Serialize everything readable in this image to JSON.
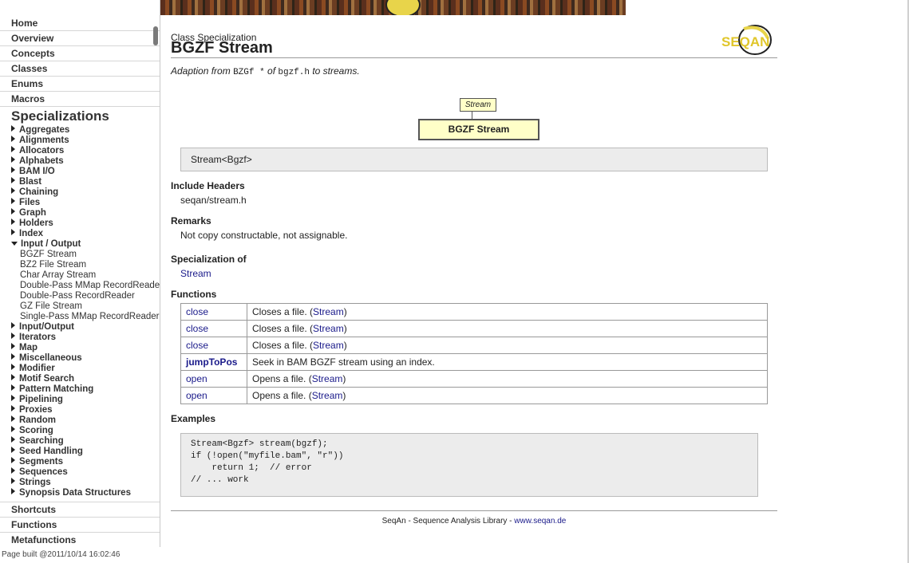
{
  "sidebar": {
    "top_nav": [
      "Home",
      "Overview",
      "Concepts",
      "Classes",
      "Enums",
      "Macros"
    ],
    "section_title": "Specializations",
    "categories_before": [
      "Aggregates",
      "Alignments",
      "Allocators",
      "Alphabets",
      "BAM I/O",
      "Blast",
      "Chaining",
      "Files",
      "Graph",
      "Holders",
      "Index"
    ],
    "expanded_category": "Input / Output",
    "expanded_items": [
      "BGZF Stream",
      "BZ2 File Stream",
      "Char Array Stream",
      "Double-Pass MMap RecordReader",
      "Double-Pass RecordReader",
      "GZ File Stream",
      "Single-Pass MMap RecordReader"
    ],
    "categories_after": [
      "Input/Output",
      "Iterators",
      "Map",
      "Miscellaneous",
      "Modifier",
      "Motif Search",
      "Pattern Matching",
      "Pipelining",
      "Proxies",
      "Random",
      "Scoring",
      "Searching",
      "Seed Handling",
      "Segments",
      "Sequences",
      "Strings",
      "Synopsis Data Structures"
    ],
    "bottom_nav": [
      "Shortcuts",
      "Functions",
      "Metafunctions"
    ],
    "build_info": "Page built @2011/10/14 16:02:46"
  },
  "page": {
    "kind": "Class Specialization",
    "title": "BGZF Stream",
    "logo_text": "SEQAN",
    "desc_prefix": "Adaption from",
    "desc_code1": "BZGf *",
    "desc_mid": "of",
    "desc_code2": "bgzf.h",
    "desc_suffix": "to streams.",
    "diagram_parent": "Stream",
    "diagram_self": "BGZF Stream",
    "signature": "Stream<Bgzf>",
    "include_heading": "Include Headers",
    "include_value": "seqan/stream.h",
    "remarks_heading": "Remarks",
    "remarks_value": "Not copy constructable, not assignable.",
    "spec_of_heading": "Specialization of",
    "spec_of_value": "Stream",
    "functions_heading": "Functions",
    "functions": [
      {
        "name": "close",
        "desc": "Closes a file.",
        "ref": "Stream",
        "bold": false
      },
      {
        "name": "close",
        "desc": "Closes a file.",
        "ref": "Stream",
        "bold": false
      },
      {
        "name": "close",
        "desc": "Closes a file.",
        "ref": "Stream",
        "bold": false
      },
      {
        "name": "jumpToPos",
        "desc": "Seek in BAM BGZF stream using an index.",
        "ref": "",
        "bold": true
      },
      {
        "name": "open",
        "desc": "Opens a file.",
        "ref": "Stream",
        "bold": false
      },
      {
        "name": "open",
        "desc": "Opens a file.",
        "ref": "Stream",
        "bold": false
      }
    ],
    "examples_heading": "Examples",
    "example_code": "Stream<Bgzf> stream(bgzf);\nif (!open(\"myfile.bam\", \"r\"))\n    return 1;  // error\n// ... work",
    "footer_text": "SeqAn - Sequence Analysis Library - ",
    "footer_link": "www.seqan.de"
  },
  "colors": {
    "link": "#1a1a8a",
    "diagram_fill": "#ffffc8",
    "code_bg": "#ececec",
    "logo_yellow": "#e8d44a"
  }
}
